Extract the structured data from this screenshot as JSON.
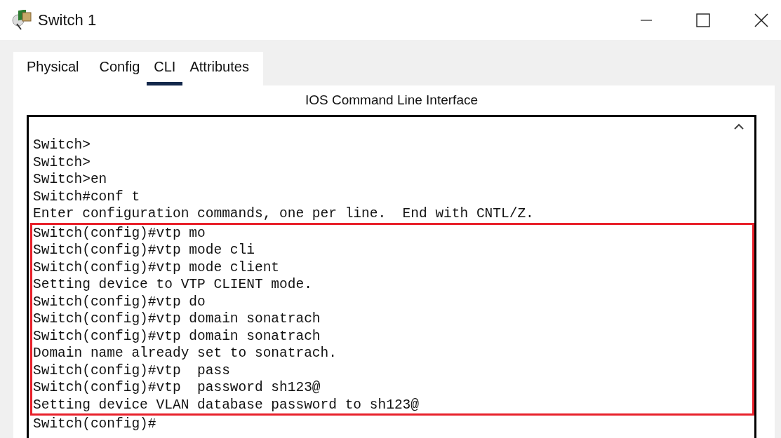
{
  "window": {
    "title": "Switch 1"
  },
  "tabs": [
    {
      "label": "Physical",
      "selected": false
    },
    {
      "label": "Config",
      "selected": false
    },
    {
      "label": "CLI",
      "selected": true
    },
    {
      "label": "Attributes",
      "selected": false
    }
  ],
  "panel_title": "IOS Command Line Interface",
  "terminal": {
    "blocks": [
      {
        "highlighted": false,
        "lines": [
          "Switch>",
          "Switch>",
          "Switch>en",
          "Switch#conf t",
          "Enter configuration commands, one per line.  End with CNTL/Z."
        ]
      },
      {
        "highlighted": true,
        "lines": [
          "Switch(config)#vtp mo",
          "Switch(config)#vtp mode cli",
          "Switch(config)#vtp mode client",
          "Setting device to VTP CLIENT mode.",
          "Switch(config)#vtp do",
          "Switch(config)#vtp domain sonatrach",
          "Switch(config)#vtp domain sonatrach",
          "Domain name already set to sonatrach.",
          "Switch(config)#vtp  pass",
          "Switch(config)#vtp  password sh123@",
          "Setting device VLAN database password to sh123@"
        ]
      },
      {
        "highlighted": false,
        "lines": [
          "Switch(config)#"
        ]
      }
    ]
  }
}
